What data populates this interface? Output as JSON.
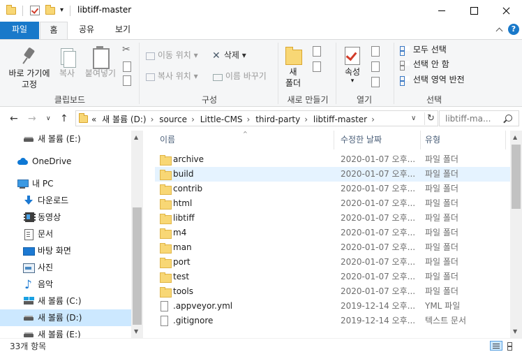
{
  "window": {
    "title": "libtiff-master",
    "quick_access_dropdown": "▾"
  },
  "ribbon_tabs": {
    "file": "파일",
    "home": "홈",
    "share": "공유",
    "view": "보기",
    "help": "?"
  },
  "clipboard": {
    "pin_label_line1": "바로 가기에",
    "pin_label_line2": "고정",
    "copy_label": "복사",
    "paste_label": "붙여넣기",
    "group_label": "클립보드"
  },
  "organize": {
    "move_to": "이동 위치 ▾",
    "copy_to": "복사 위치 ▾",
    "delete": "삭제 ▾",
    "rename": "이름 바꾸기",
    "group_label": "구성"
  },
  "new": {
    "new_folder_line1": "새",
    "new_folder_line2": "폴더",
    "group_label": "새로 만들기"
  },
  "open": {
    "properties": "속성",
    "properties_dropdown": "▾",
    "group_label": "열기"
  },
  "select": {
    "select_all": "모두 선택",
    "select_none": "선택 안 함",
    "invert_selection": "선택 영역 반전",
    "group_label": "선택"
  },
  "navigation": {
    "back": "←",
    "forward": "→",
    "recent_dropdown": "∨",
    "up": "↑"
  },
  "address": {
    "overflow": "«",
    "crumbs": [
      "새 볼륨 (D:)",
      "source",
      "Little-CMS",
      "third-party",
      "libtiff-master"
    ],
    "separator": "›",
    "dropdown": "∨",
    "refresh": "↻"
  },
  "search": {
    "placeholder": "libtiff-ma..."
  },
  "nav_pane": {
    "items": [
      {
        "label": "새 볼륨 (E:)",
        "icon": "drive-icon"
      },
      {
        "label": "OneDrive",
        "icon": "onedrive-icon"
      },
      {
        "label": "내 PC",
        "icon": "pc-icon"
      },
      {
        "label": "다운로드",
        "icon": "downloads-icon"
      },
      {
        "label": "동영상",
        "icon": "videos-icon"
      },
      {
        "label": "문서",
        "icon": "documents-icon"
      },
      {
        "label": "바탕 화면",
        "icon": "desktop-icon"
      },
      {
        "label": "사진",
        "icon": "pictures-icon"
      },
      {
        "label": "음악",
        "icon": "music-icon"
      },
      {
        "label": "새 볼륨 (C:)",
        "icon": "drive-c-icon"
      },
      {
        "label": "새 볼륨 (D:)",
        "icon": "drive-icon"
      },
      {
        "label": "새 볼륨 (E:)",
        "icon": "drive-icon"
      }
    ]
  },
  "file_list": {
    "columns": {
      "name": "이름",
      "date": "수정한 날짜",
      "type": "유형"
    },
    "rows": [
      {
        "name": "archive",
        "date": "2020-01-07 오후...",
        "type": "파일 폴더",
        "kind": "folder"
      },
      {
        "name": "build",
        "date": "2020-01-07 오후...",
        "type": "파일 폴더",
        "kind": "folder"
      },
      {
        "name": "contrib",
        "date": "2020-01-07 오후...",
        "type": "파일 폴더",
        "kind": "folder"
      },
      {
        "name": "html",
        "date": "2020-01-07 오후...",
        "type": "파일 폴더",
        "kind": "folder"
      },
      {
        "name": "libtiff",
        "date": "2020-01-07 오후...",
        "type": "파일 폴더",
        "kind": "folder"
      },
      {
        "name": "m4",
        "date": "2020-01-07 오후...",
        "type": "파일 폴더",
        "kind": "folder"
      },
      {
        "name": "man",
        "date": "2020-01-07 오후...",
        "type": "파일 폴더",
        "kind": "folder"
      },
      {
        "name": "port",
        "date": "2020-01-07 오후...",
        "type": "파일 폴더",
        "kind": "folder"
      },
      {
        "name": "test",
        "date": "2020-01-07 오후...",
        "type": "파일 폴더",
        "kind": "folder"
      },
      {
        "name": "tools",
        "date": "2020-01-07 오후...",
        "type": "파일 폴더",
        "kind": "folder"
      },
      {
        "name": ".appveyor.yml",
        "date": "2019-12-14 오후...",
        "type": "YML 파일",
        "kind": "file"
      },
      {
        "name": ".gitignore",
        "date": "2019-12-14 오후...",
        "type": "텍스트 문서",
        "kind": "file"
      }
    ]
  },
  "status": {
    "item_count": "33개 항목"
  }
}
